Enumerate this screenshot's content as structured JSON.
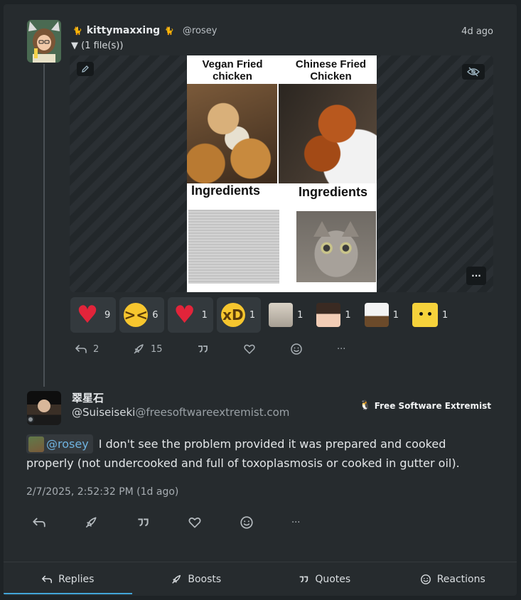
{
  "post": {
    "display_name": "kittymaxxing",
    "handle": "@rosey",
    "time_ago": "4d ago",
    "files_toggle": "▼ (1 file(s))",
    "media": {
      "label_left": "Vegan Fried chicken",
      "label_right": "Chinese Fried Chicken",
      "ingredients_left": "Ingredients",
      "ingredients_right": "Ingredients",
      "edit_icon": "pencil-icon",
      "hide_icon": "eye-off-icon",
      "more_label": "···"
    },
    "reactions": [
      {
        "icon": "heart-emoji",
        "glyph": "♥",
        "count": "9"
      },
      {
        "icon": "laughing-emoji",
        "glyph": "😆",
        "count": "6"
      },
      {
        "icon": "red-heart-emoji",
        "glyph": "♥",
        "count": "1"
      },
      {
        "icon": "rofl-emoji",
        "glyph": "🤣",
        "count": "1"
      },
      {
        "icon": "cat-custom-emoji",
        "glyph": "",
        "count": "1"
      },
      {
        "icon": "anime-girl-custom-emoji",
        "glyph": "",
        "count": "1"
      },
      {
        "icon": "eagle-custom-emoji",
        "glyph": "",
        "count": "1"
      },
      {
        "icon": "surprised-pikachu-emoji",
        "glyph": "",
        "count": "1"
      }
    ],
    "actions": {
      "replies": "2",
      "boosts": "15",
      "more": "···"
    }
  },
  "reply": {
    "display_name": "翠星石",
    "handle_user": "@Suiseiseki",
    "handle_domain": "@freesoftwareextremist.com",
    "instance_badge": "Free Software Extremist",
    "mention": "@rosey",
    "content": "I don't see the problem provided it was prepared and cooked properly (not undercooked and full of toxoplasmosis or cooked in gutter oil).",
    "date": "2/7/2025, 2:52:32 PM (1d ago)",
    "more": "···"
  },
  "tabs": [
    {
      "label": "Replies",
      "icon": "reply-icon",
      "active": true
    },
    {
      "label": "Boosts",
      "icon": "rocket-icon",
      "active": false
    },
    {
      "label": "Quotes",
      "icon": "quote-icon",
      "active": false
    },
    {
      "label": "Reactions",
      "icon": "smile-icon",
      "active": false
    }
  ],
  "colors": {
    "background": "#1e2326",
    "panel": "#262b2e",
    "accent": "#42a5d8",
    "mention": "#6fb3e0",
    "heart": "#e2243a"
  }
}
